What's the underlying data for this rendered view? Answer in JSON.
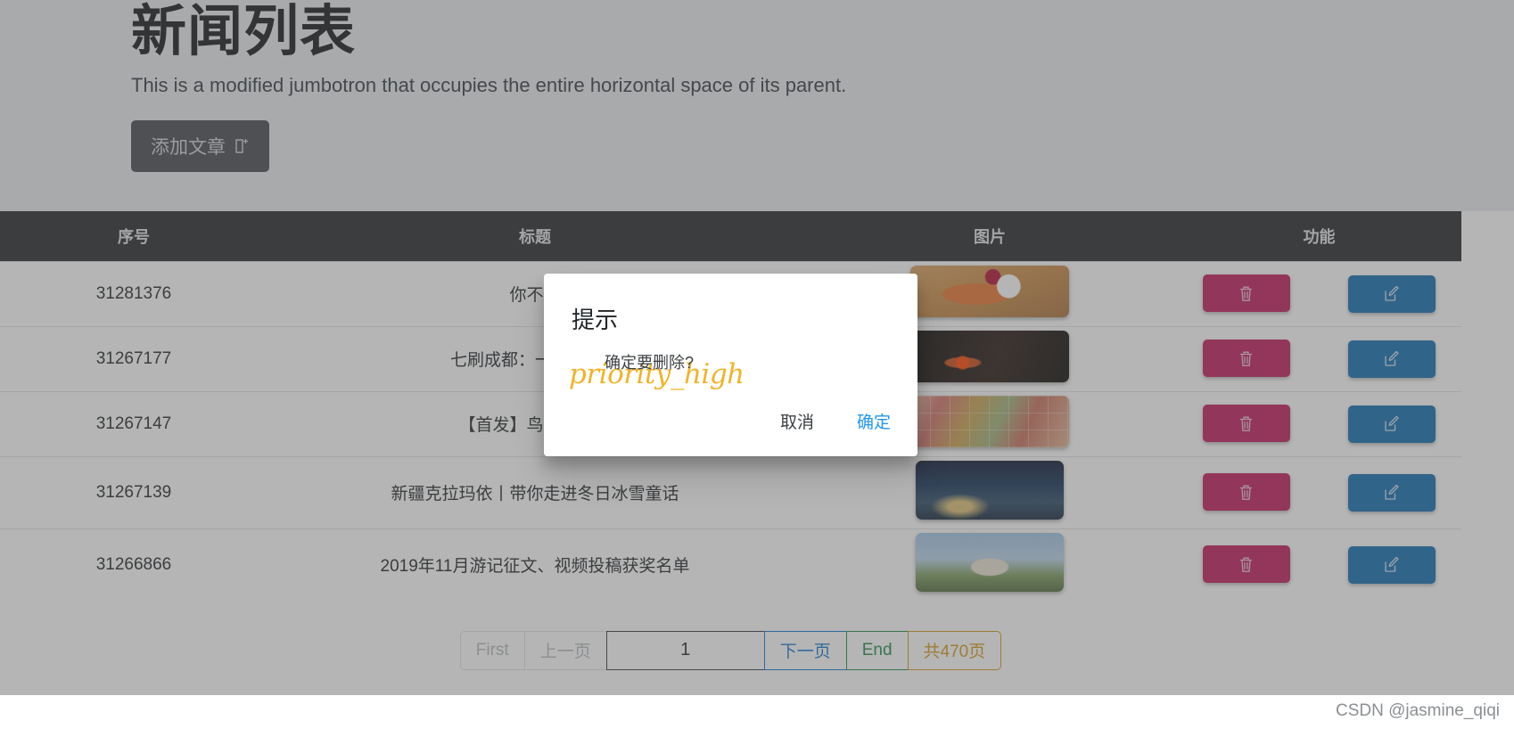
{
  "jumbotron": {
    "title": "新闻列表",
    "subtitle": "This is a modified jumbotron that occupies the entire horizontal space of its parent.",
    "add_button_label": "添加文章",
    "add_button_icon": "file-plus-icon"
  },
  "table": {
    "headers": [
      "序号",
      "标题",
      "图片",
      "功能"
    ],
    "rows": [
      {
        "id": "31281376",
        "title": "你不必",
        "thumb": "pancake-dessert-photo",
        "delete_icon": "trash-icon",
        "edit_icon": "pencil-square-icon"
      },
      {
        "id": "31267177",
        "title": "七刷成都：一场关于文",
        "thumb": "dark-lantern-photo",
        "delete_icon": "trash-icon",
        "edit_icon": "pencil-square-icon"
      },
      {
        "id": "31267147",
        "title": "【首发】鸟取之味，",
        "thumb": "food-collage-photo",
        "delete_icon": "trash-icon",
        "edit_icon": "pencil-square-icon"
      },
      {
        "id": "31267139",
        "title": "新疆克拉玛依丨带你走进冬日冰雪童话",
        "thumb": "night-city-photo",
        "delete_icon": "trash-icon",
        "edit_icon": "pencil-square-icon"
      },
      {
        "id": "31266866",
        "title": "2019年11月游记征文、视频投稿获奖名单",
        "thumb": "snow-bear-photo",
        "delete_icon": "trash-icon",
        "edit_icon": "pencil-square-icon"
      }
    ]
  },
  "pagination": {
    "first": "First",
    "prev": "上一页",
    "current_page": "1",
    "next": "下一页",
    "end": "End",
    "total": "共470页"
  },
  "modal": {
    "title": "提示",
    "message": "确定要删除?",
    "icon_text": "priority_high",
    "icon_name": "priority-high-icon",
    "cancel": "取消",
    "confirm": "确定"
  },
  "watermark": "CSDN @jasmine_qiqi",
  "colors": {
    "delete": "#c2185b",
    "edit": "#0f6cb0",
    "header_bg": "#212529",
    "jumbotron_bg": "#e9ecef",
    "next": "#1177d1",
    "end": "#1f8a41",
    "total": "#d39a19",
    "confirm": "#2196f3",
    "icon_warning": "#f0b429"
  }
}
